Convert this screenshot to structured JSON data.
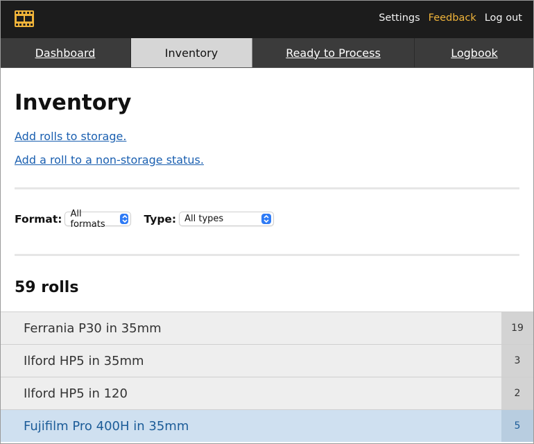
{
  "header": {
    "logo_icon": "film-strip-icon",
    "nav": [
      {
        "label": "Settings",
        "accent": false
      },
      {
        "label": "Feedback",
        "accent": true
      },
      {
        "label": "Log out",
        "accent": false
      }
    ]
  },
  "tabs": [
    {
      "label": "Dashboard",
      "active": false
    },
    {
      "label": "Inventory",
      "active": true
    },
    {
      "label": "Ready to Process",
      "active": false
    },
    {
      "label": "Logbook",
      "active": false
    }
  ],
  "main": {
    "title": "Inventory",
    "add_storage_link": "Add rolls to storage.",
    "add_status_link": "Add a roll to a non-storage status.",
    "filters": {
      "format_label": "Format:",
      "format_value": "All formats",
      "type_label": "Type:",
      "type_value": "All types"
    },
    "roll_count": "59 rolls",
    "rolls": [
      {
        "name": "Ferrania P30 in 35mm",
        "count": "19"
      },
      {
        "name": "Ilford HP5 in 35mm",
        "count": "3"
      },
      {
        "name": "Ilford HP5 in 120",
        "count": "2"
      },
      {
        "name": "Fujifilm Pro 400H in 35mm",
        "count": "5"
      }
    ]
  },
  "colors": {
    "accent": "#f0b43a",
    "link": "#1a5fb0",
    "select_chevron": "#2f7bf5"
  }
}
